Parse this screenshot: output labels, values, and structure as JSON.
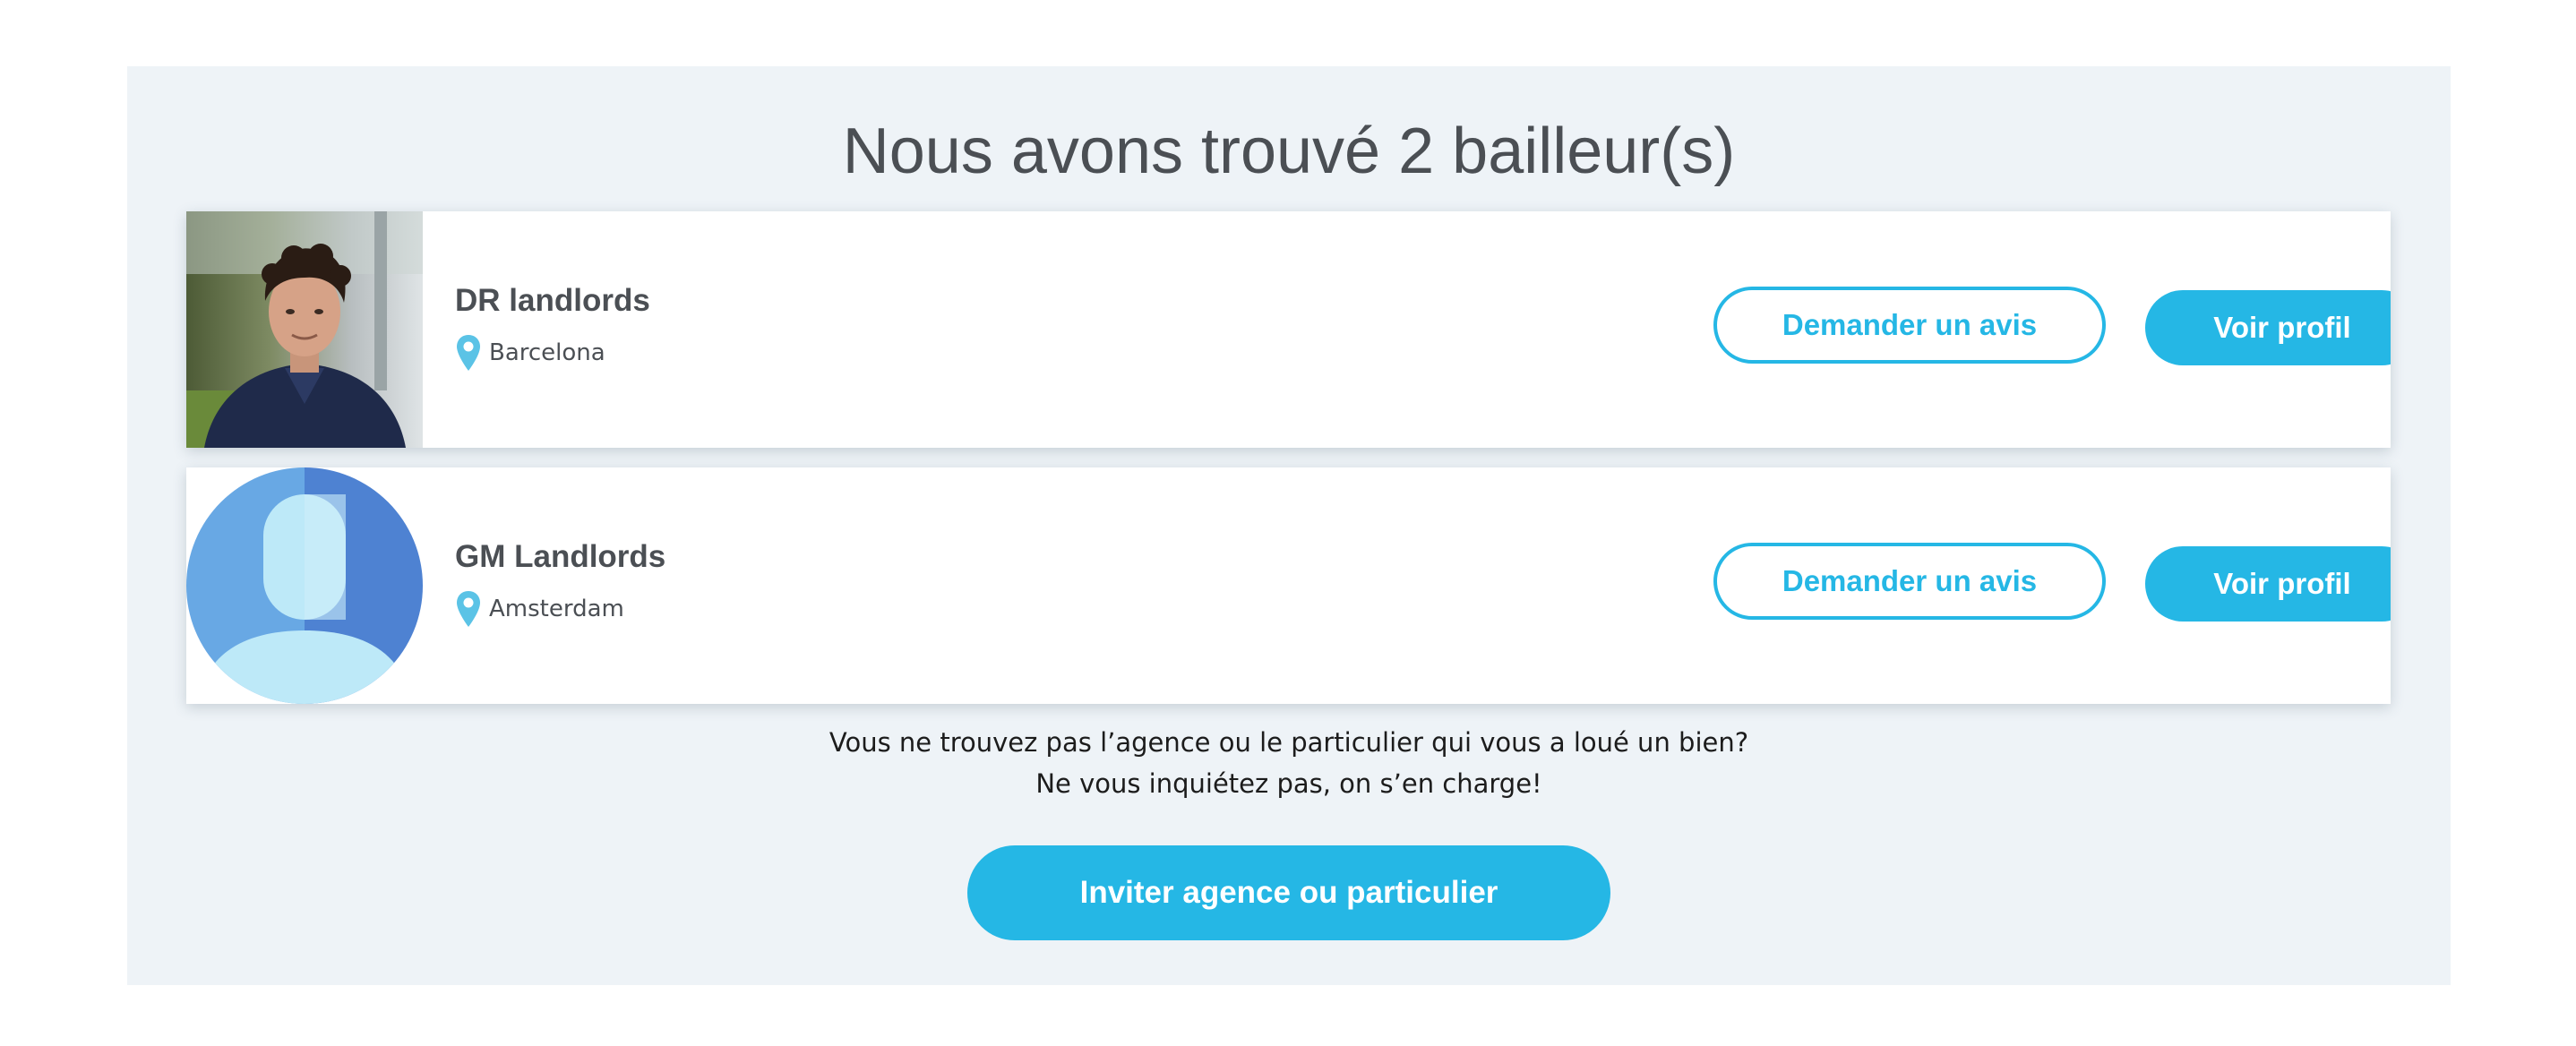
{
  "results": {
    "title": "Nous avons trouvé 2 bailleur(s)"
  },
  "landlords": [
    {
      "name": "DR landlords",
      "location": "Barcelona",
      "avatar": "photo-avatar",
      "request_review_label": "Demander un avis",
      "view_profile_label": "Voir profil"
    },
    {
      "name": "GM Landlords",
      "location": "Amsterdam",
      "avatar": "default-user-avatar",
      "request_review_label": "Demander un avis",
      "view_profile_label": "Voir profil"
    }
  ],
  "footer": {
    "line1": "Vous ne trouvez pas l’agence ou le particulier qui vous a loué un bien?",
    "line2": "Ne vous inquiétez pas, on s’en charge!",
    "invite_label": "Inviter agence ou particulier"
  },
  "colors": {
    "accent": "#25b7e5",
    "panel_bg": "#eef3f7",
    "text": "#4b4f54",
    "pin": "#5bc3e6"
  },
  "icons": {
    "location": "location-pin-icon"
  }
}
